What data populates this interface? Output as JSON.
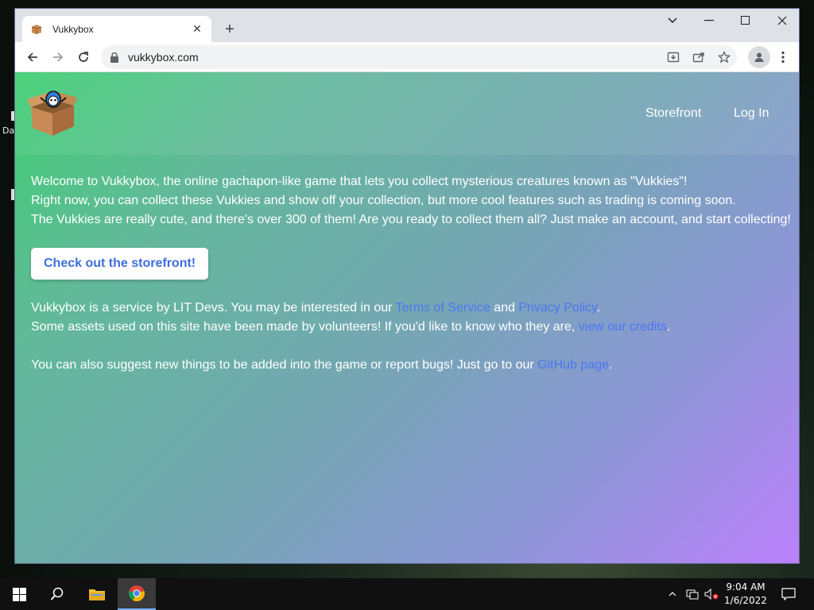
{
  "desktop": {
    "icon_labels": [
      "Da"
    ]
  },
  "browser": {
    "tab_title": "Vukkybox",
    "url": "vukkybox.com"
  },
  "site": {
    "nav": {
      "storefront": "Storefront",
      "login": "Log In"
    },
    "intro": [
      "Welcome to Vukkybox, the online gachapon-like game that lets you collect mysterious creatures known as \"Vukkies\"!",
      "Right now, you can collect these Vukkies and show off your collection, but more cool features such as trading is coming soon.",
      "The Vukkies are really cute, and there's over 300 of them! Are you ready to collect them all? Just make an account, and start collecting!"
    ],
    "cta_label": "Check out the storefront!",
    "about": {
      "line1_prefix": "Vukkybox is a service by LIT Devs. You may be interested in our ",
      "terms": "Terms of Service",
      "and": " and ",
      "privacy": "Privacy Policy",
      "line1_suffix": ".",
      "line2_prefix": "Some assets used on this site have been made by volunteers! If you'd like to know who they are, ",
      "credits": "view our credits",
      "line2_suffix": "."
    },
    "suggest": {
      "prefix": "You can also suggest new things to be added into the game or report bugs! Just go to our ",
      "github": "GitHub page",
      "suffix": "."
    }
  },
  "taskbar": {
    "time": "9:04 AM",
    "date": "1/6/2022"
  },
  "colors": {
    "link": "#4a78f0",
    "cta_text": "#3f6fdc",
    "gradient_start": "#3fcf72",
    "gradient_end": "#bb80fb"
  }
}
